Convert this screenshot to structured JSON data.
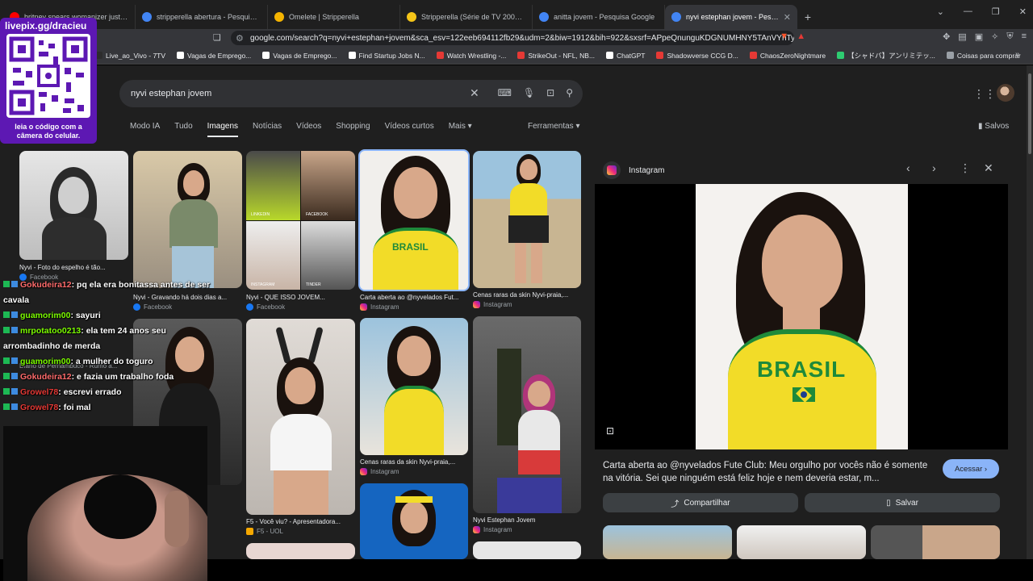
{
  "browser": {
    "tabs": [
      {
        "title": "britney spears womanizer just dance",
        "favicon_color": "#ff0000",
        "active": false
      },
      {
        "title": "stripperella abertura - Pesquisa Goog",
        "favicon_color": "#4285f4",
        "active": false
      },
      {
        "title": "Omelete | Stripperella",
        "favicon_color": "#f5b400",
        "active": false
      },
      {
        "title": "Stripperella (Série de TV 2003–2004)",
        "favicon_color": "#f5c518",
        "active": false
      },
      {
        "title": "anitta jovem - Pesquisa Google",
        "favicon_color": "#4285f4",
        "active": false
      },
      {
        "title": "nyvi estephan jovem - Pesquisa Goog",
        "favicon_color": "#4285f4",
        "active": true
      }
    ],
    "new_tab_glyph": "+",
    "url": "google.com/search?q=nyvi+estephan+jovem&sca_esv=122eeb694112fb29&udm=2&biw=1912&bih=922&sxsrf=APpeQnunguKDGNUMHNY5TAnVYnTy...",
    "bookmarks": [
      {
        "label": "Live_ao_Vivo - 7TV",
        "color": "#2d2d2d"
      },
      {
        "label": "Vagas de Emprego...",
        "color": "#ffffff"
      },
      {
        "label": "Vagas de Emprego...",
        "color": "#ffffff"
      },
      {
        "label": "Find Startup Jobs N...",
        "color": "#ffffff"
      },
      {
        "label": "Watch Wrestling -...",
        "color": "#e53935"
      },
      {
        "label": "StrikeOut - NFL, NB...",
        "color": "#e53935"
      },
      {
        "label": "ChatGPT",
        "color": "#ffffff"
      },
      {
        "label": "Shadowverse CCG D...",
        "color": "#e53935"
      },
      {
        "label": "ChaosZeroNightmare",
        "color": "#e53935"
      },
      {
        "label": "【シャドバ】アンリミテッ...",
        "color": "#2ecc71"
      },
      {
        "label": "Coisas para comprar",
        "color": "#9aa0a6"
      }
    ],
    "bookmarks_more": "»"
  },
  "search": {
    "query": "nyvi estephan jovem",
    "tabs": [
      "Modo IA",
      "Tudo",
      "Imagens",
      "Notícias",
      "Vídeos",
      "Shopping",
      "Vídeos curtos",
      "Mais ▾"
    ],
    "active_tab": "Imagens",
    "tools_label": "Ferramentas ▾",
    "saved_label": "Salvos"
  },
  "results": [
    {
      "caption": "Nyvi - Foto do espelho é tão...",
      "source": "Facebook",
      "src_type": "fb"
    },
    {
      "caption": "Nyvi - Gravando há dois dias a...",
      "source": "Facebook",
      "src_type": "fb"
    },
    {
      "caption": "Nyvi - QUE ISSO JOVEM...",
      "source": "Facebook",
      "src_type": "fb"
    },
    {
      "caption": "Carta aberta ao @nyvelados Fut...",
      "source": "Instagram",
      "src_type": "ig"
    },
    {
      "caption": "Cenas raras da skin Nyvi-praia,...",
      "source": "Instagram",
      "src_type": "ig"
    },
    {
      "caption": "Diario de Pernambuco - Rumo a...",
      "source": "",
      "src_type": ""
    },
    {
      "caption": "F5 - Você viu? - Apresentadora...",
      "source": "F5 - UOL",
      "src_type": "f5"
    },
    {
      "caption": "Cenas raras da skin Nyvi-praia,...",
      "source": "Instagram",
      "src_type": "ig"
    },
    {
      "caption": "Nyvi Estephan Jovem",
      "source": "Instagram",
      "src_type": "ig"
    }
  ],
  "collage_labels": [
    "LINKEDIN",
    "FACEBOOK",
    "INSTAGRAM",
    "TINDER"
  ],
  "panel": {
    "source": "Instagram",
    "shirt_text": "BRASIL",
    "title": "Carta aberta ao @nyvelados Fute Club: Meu orgulho por vocês não é somente na vitória. Sei que ninguém está feliz hoje e nem deveria estar, m...",
    "visit_label": "Acessar ›",
    "share_label": "Compartilhar",
    "save_label": "Salvar"
  },
  "overlay": {
    "qr_url": "livepix.gg/dracieu",
    "qr_caption": "leia o código com a câmera do celular.",
    "chat": [
      {
        "user": "Gokudeira12",
        "user_color": "#ff6b6b",
        "message": ": pq ela era bonitassa antes de ser cavala"
      },
      {
        "user": "guamorim00",
        "user_color": "#7cfc00",
        "message": ": sayuri"
      },
      {
        "user": "mrpotatoo0213",
        "user_color": "#7cfc00",
        "message": ": ela tem 24 anos seu arrombadinho de merda"
      },
      {
        "user": "guamorim00",
        "user_color": "#7cfc00",
        "message": ": a mulher do toguro"
      },
      {
        "user": "Gokudeira12",
        "user_color": "#ff6b6b",
        "message": ": e fazia um trabalho foda"
      },
      {
        "user": "Growel78",
        "user_color": "#e53935",
        "message": ": escrevi errado"
      },
      {
        "user": "Growel78",
        "user_color": "#e53935",
        "message": ": foi mal"
      }
    ]
  },
  "colors": {
    "page_bg": "#1f1f1f",
    "accent_blue": "#8ab4f8",
    "qr_purple": "#5d18b3",
    "shirt_yellow": "#f2dc28",
    "shirt_green": "#1f8a3a"
  }
}
